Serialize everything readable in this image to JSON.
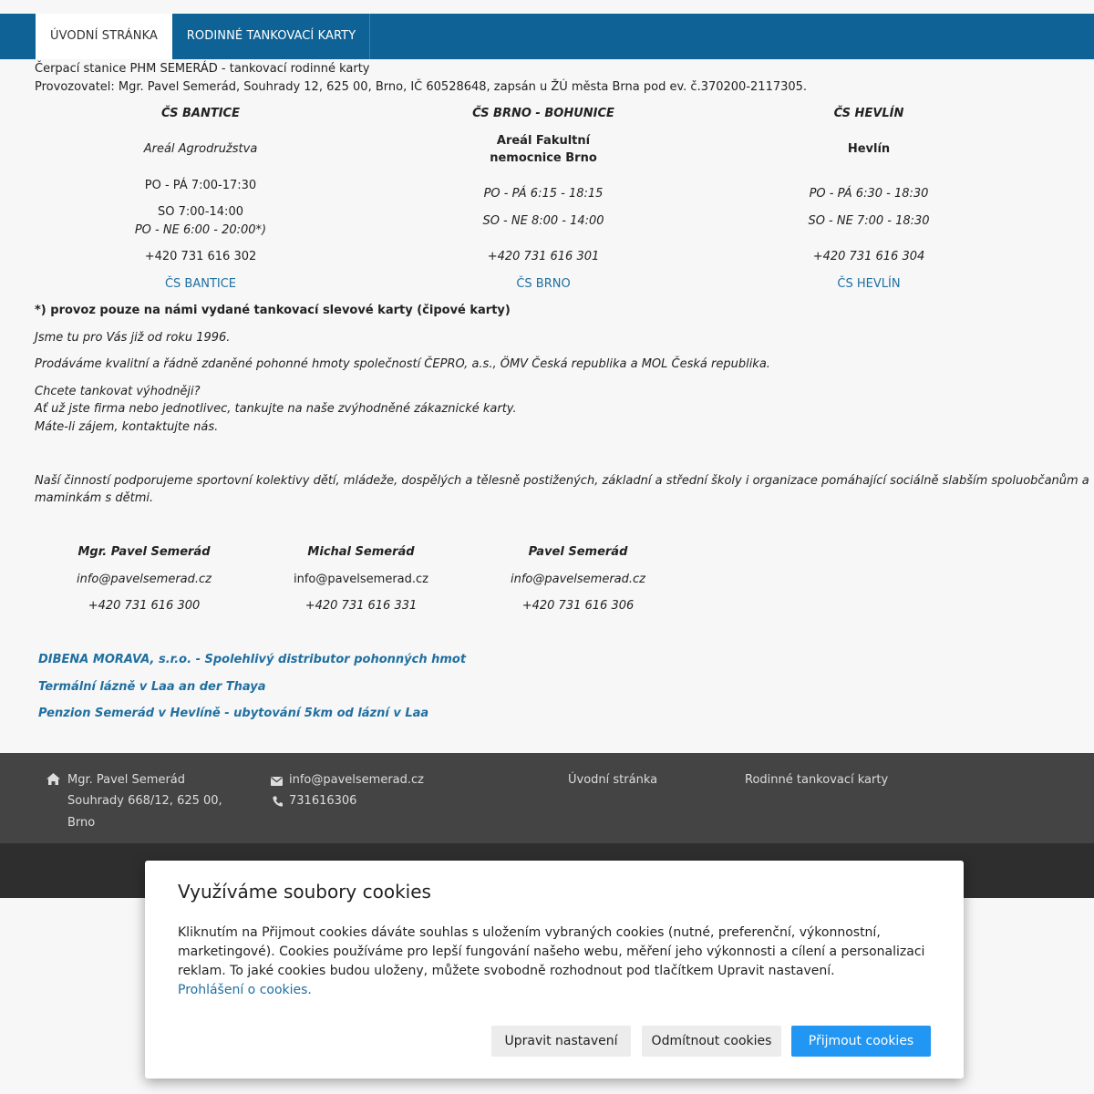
{
  "nav": {
    "tabs": [
      {
        "label": "ÚVODNÍ STRÁNKA"
      },
      {
        "label": "RODINNÉ TANKOVACÍ KARTY"
      }
    ]
  },
  "intro": {
    "line1": "Čerpací stanice PHM SEMERÁD - tankovací rodinné karty",
    "line2": "Provozovatel: Mgr. Pavel Semerád, Souhrady 12, 625 00, Brno, IČ 60528648, zapsán u ŽÚ města Brna pod ev. č.370200-2117305."
  },
  "stations": [
    {
      "name": "ČS BANTICE",
      "place": "Areál Agrodružstva",
      "hours1": "PO - PÁ 7:00-17:30",
      "hours2": "SO 7:00-14:00",
      "hours3": "PO - NE 6:00 - 20:00*)",
      "phone": "+420 731 616 302",
      "link": "ČS BANTICE"
    },
    {
      "name": "ČS BRNO - BOHUNICE",
      "place_line1": "Areál Fakultní",
      "place_line2": "nemocnice Brno",
      "hours1": "PO - PÁ 6:15 - 18:15",
      "hours2": "SO - NE 8:00 - 14:00",
      "phone": "+420 731 616 301",
      "link": "ČS BRNO"
    },
    {
      "name": "ČS HEVLÍN",
      "place": "Hevlín",
      "hours1": "PO - PÁ 6:30 - 18:30",
      "hours2": "SO - NE 7:00 - 18:30",
      "phone": "+420 731 616 304",
      "link": "ČS HEVLÍN"
    }
  ],
  "texts": {
    "note": " *) provoz pouze na námi vydané tankovací slevové karty (čipové karty)",
    "since": "Jsme tu pro Vás již od roku 1996.",
    "sell": "Prodáváme kvalitní a řádně zdaněné pohonné hmoty společností ČEPRO, a.s., ÖMV Česká republika a MOL Česká republika.",
    "cheaper1": "Chcete tankovat výhodněji?",
    "cheaper2": "Ať už jste firma nebo jednotlivec, tankujte na naše zvýhodněné zákaznické karty.",
    "cheaper3": "Máte-li zájem, kontaktujte nás.",
    "support1": "Naší činností podporujeme sportovní kolektivy dětí, mládeže, dospělých a tělesně postižených, základní a střední školy i organizace pomáhající sociálně slabším spoluobčanům a",
    "support2": "maminkám s dětmi."
  },
  "contacts": [
    {
      "name": "Mgr. Pavel Semerád",
      "email": "info@pavelsemerad.cz",
      "phone": "+420 731 616 300"
    },
    {
      "name": "Michal Semerád",
      "email": "info@pavelsemerad.cz",
      "phone": "+420 731 616 331"
    },
    {
      "name": "Pavel Semerád",
      "email": "info@pavelsemerad.cz",
      "phone": "+420 731 616 306"
    }
  ],
  "links": [
    "DIBENA MORAVA, s.r.o. - Spolehlivý distributor pohonných hmot",
    "Termální lázně v Laa an der Thaya",
    "Penzion Semerád v Hevlíně - ubytování 5km od lázní v Laa"
  ],
  "footer": {
    "addr1": "Mgr. Pavel Semerád",
    "addr2": "Souhrady 668/12, 625 00,",
    "addr3": "Brno",
    "email": "info@pavelsemerad.cz",
    "phone": "731616306",
    "nav1": "Úvodní stránka",
    "nav2": "Rodinné tankovací karty"
  },
  "cookies": {
    "title": "Využíváme soubory cookies",
    "body": "Kliknutím na Přijmout cookies dáváte souhlas s uložením vybraných cookies (nutné, preferenční, výkonnostní, marketingové). Cookies používáme pro lepší fungování našeho webu, měření jeho výkonnosti a cílení a personalizaci reklam. To jaké cookies budou uloženy, můžete svobodně rozhodnout pod tlačítkem Upravit nastavení.",
    "link": "Prohlášení o cookies.",
    "btn_settings": "Upravit nastavení",
    "btn_reject": "Odmítnout cookies",
    "btn_accept": "Přijmout cookies"
  },
  "colors": {
    "nav": "#0e6296",
    "link": "#1f6fa0",
    "accept": "#2196f3",
    "footer": "#444444"
  }
}
